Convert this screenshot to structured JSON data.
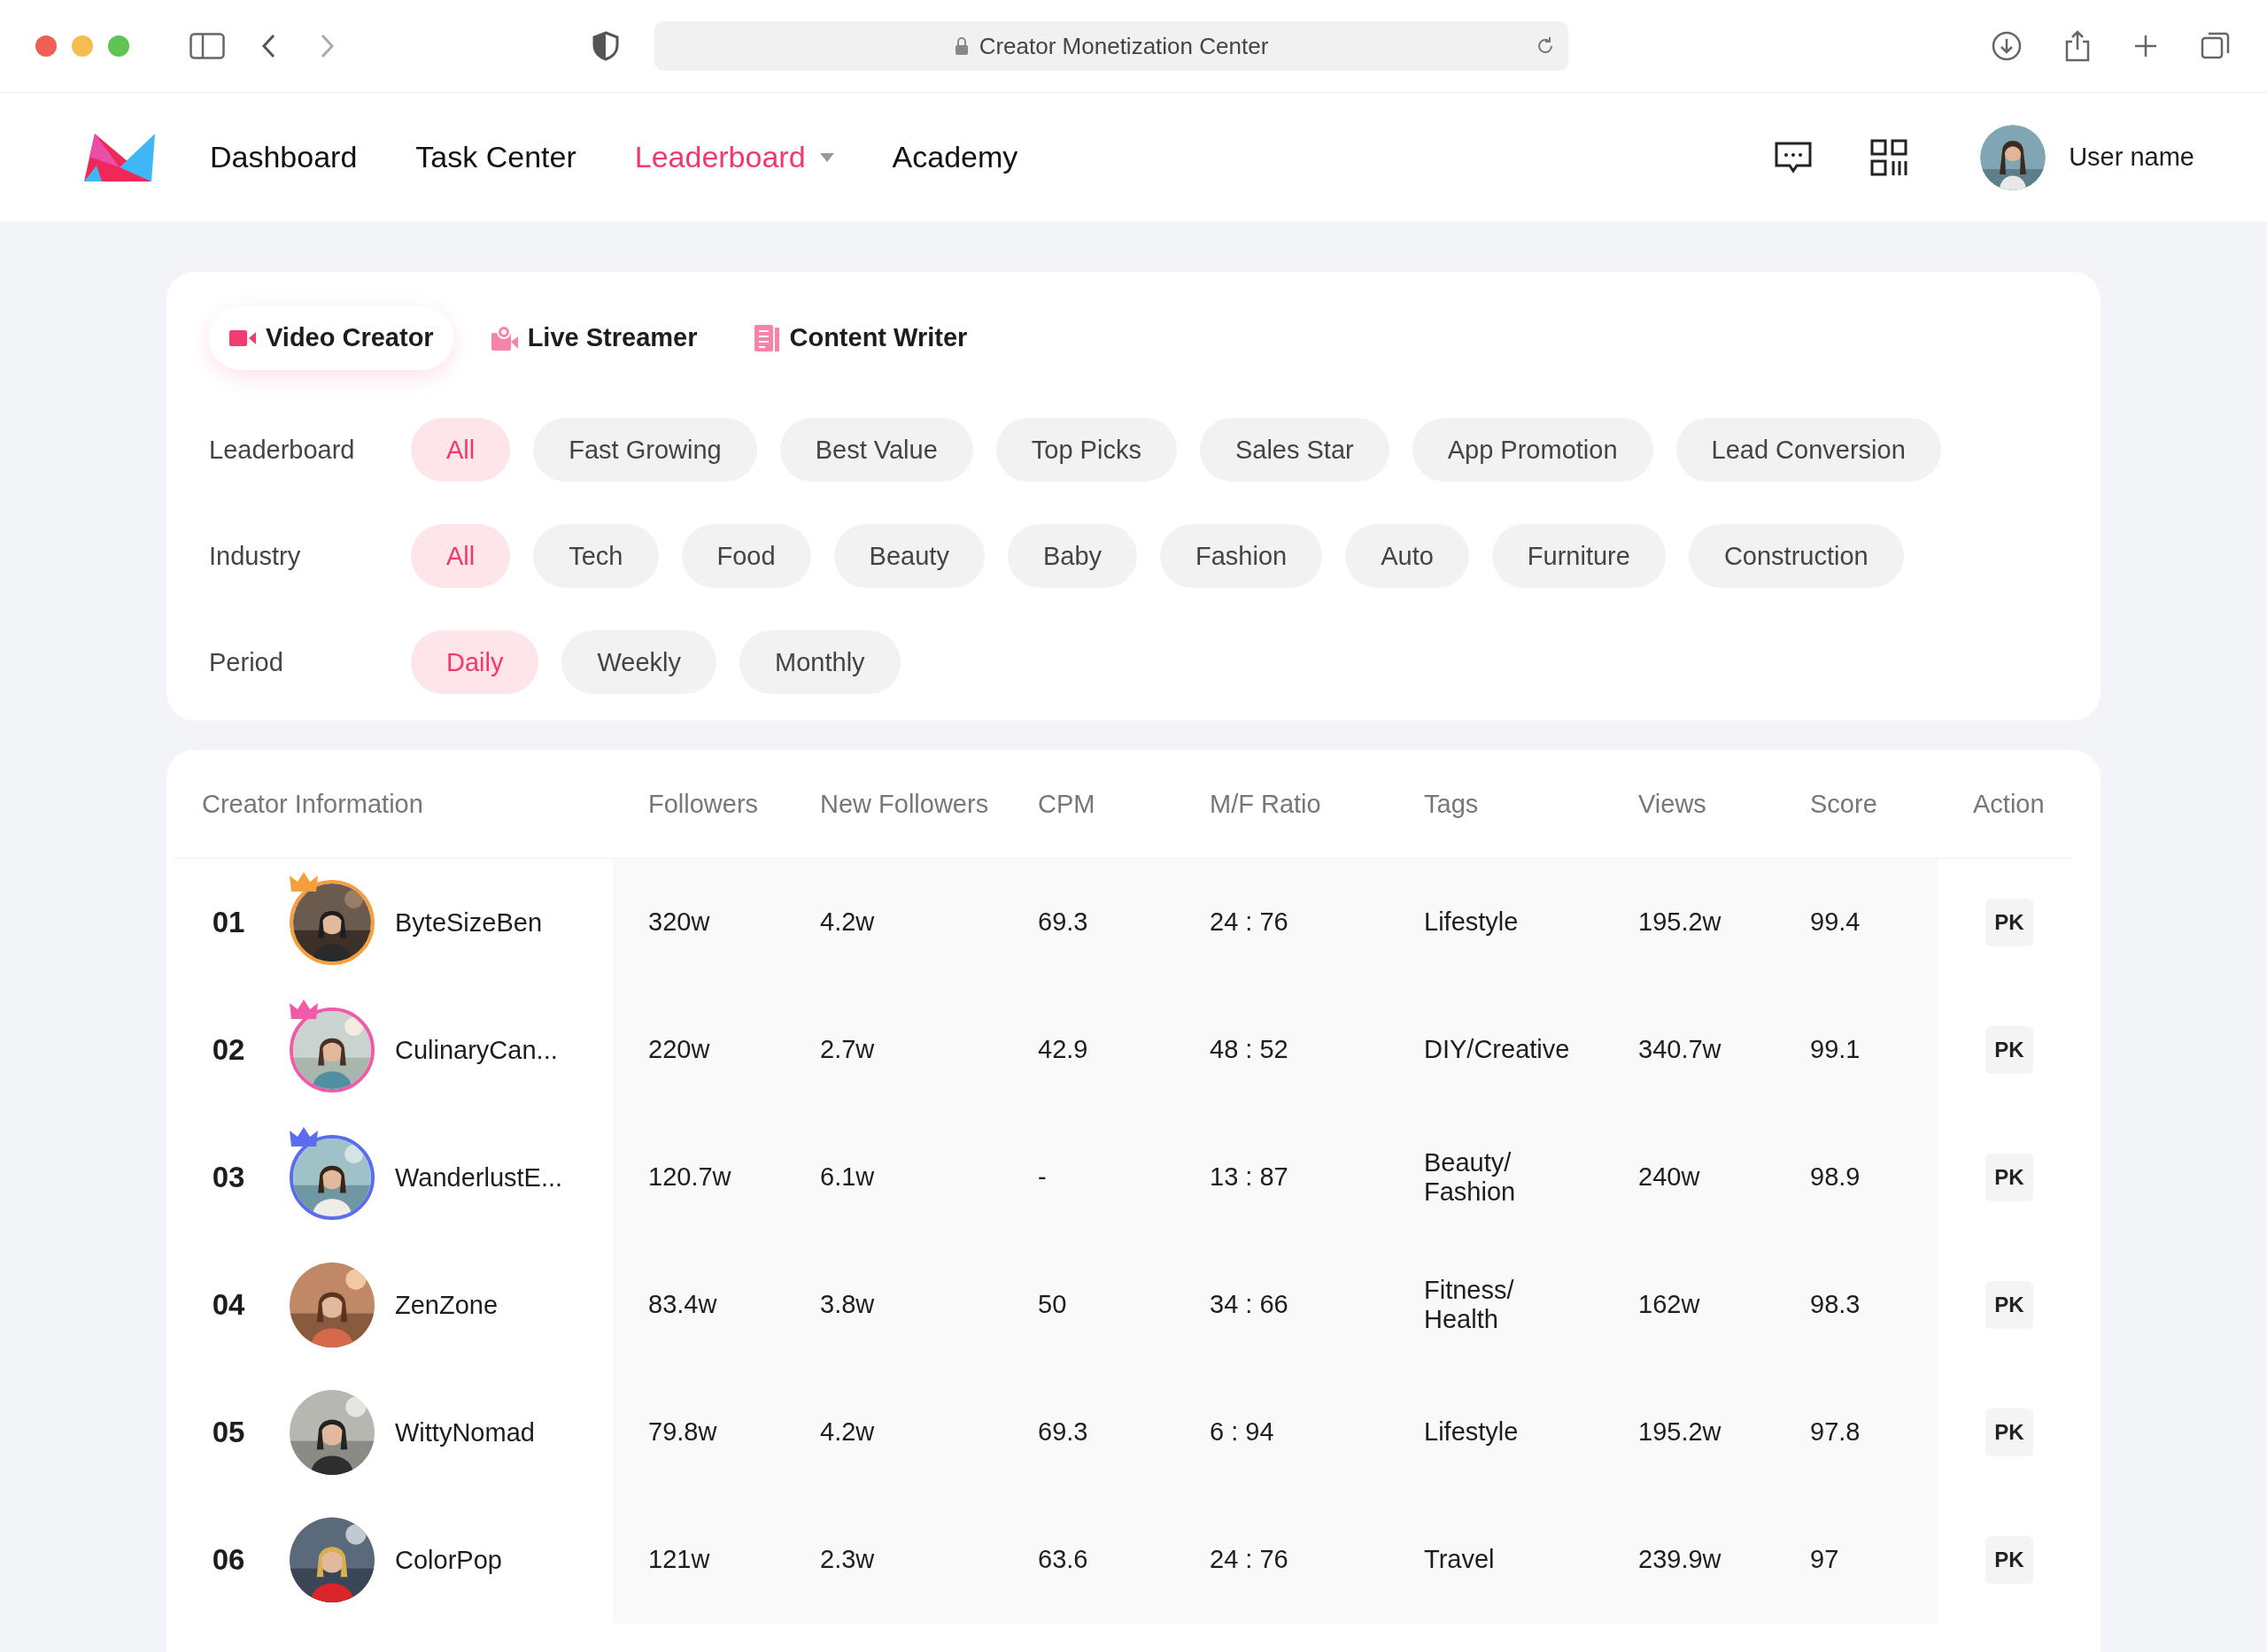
{
  "browser": {
    "url": "Creator Monetization Center"
  },
  "nav": {
    "items": [
      {
        "label": "Dashboard",
        "selected": false,
        "dropdown": false
      },
      {
        "label": "Task Center",
        "selected": false,
        "dropdown": false
      },
      {
        "label": "Leaderboard",
        "selected": true,
        "dropdown": true
      },
      {
        "label": "Academy",
        "selected": false,
        "dropdown": false
      }
    ],
    "user": "User name"
  },
  "creator_types": [
    {
      "label": "Video Creator",
      "selected": true,
      "kind": "video"
    },
    {
      "label": "Live Streamer",
      "selected": false,
      "kind": "live"
    },
    {
      "label": "Content Writer",
      "selected": false,
      "kind": "writer"
    }
  ],
  "filters": [
    {
      "label": "Leaderboard",
      "options": [
        {
          "label": "All",
          "selected": true
        },
        {
          "label": "Fast Growing",
          "selected": false
        },
        {
          "label": "Best Value",
          "selected": false
        },
        {
          "label": "Top Picks",
          "selected": false
        },
        {
          "label": "Sales Star",
          "selected": false
        },
        {
          "label": "App Promotion",
          "selected": false
        },
        {
          "label": "Lead Conversion",
          "selected": false
        }
      ]
    },
    {
      "label": "Industry",
      "options": [
        {
          "label": "All",
          "selected": true
        },
        {
          "label": "Tech",
          "selected": false
        },
        {
          "label": "Food",
          "selected": false
        },
        {
          "label": "Beauty",
          "selected": false
        },
        {
          "label": "Baby",
          "selected": false
        },
        {
          "label": "Fashion",
          "selected": false
        },
        {
          "label": "Auto",
          "selected": false
        },
        {
          "label": "Furniture",
          "selected": false
        },
        {
          "label": "Construction",
          "selected": false
        }
      ]
    },
    {
      "label": "Period",
      "options": [
        {
          "label": "Daily",
          "selected": true
        },
        {
          "label": "Weekly",
          "selected": false
        },
        {
          "label": "Monthly",
          "selected": false
        }
      ]
    }
  ],
  "table": {
    "columns": [
      "Creator Information",
      "Followers",
      "New Followers",
      "CPM",
      "M/F Ratio",
      "Tags",
      "Views",
      "Score",
      "Action"
    ],
    "rows": [
      {
        "rank": "01",
        "name": "ByteSizeBen",
        "color": "#f5a03c",
        "followers": "320w",
        "new_followers": "4.2w",
        "cpm": "69.3",
        "mf_ratio": "24 : 76",
        "tags": "Lifestyle",
        "views": "195.2w",
        "score": "99.4",
        "action": "PK"
      },
      {
        "rank": "02",
        "name": "CulinaryCan...",
        "color": "#f05aa8",
        "followers": "220w",
        "new_followers": "2.7w",
        "cpm": "42.9",
        "mf_ratio": "48 : 52",
        "tags": "DIY/Creative",
        "views": "340.7w",
        "score": "99.1",
        "action": "PK"
      },
      {
        "rank": "03",
        "name": "WanderlustE...",
        "color": "#5a6cf0",
        "followers": "120.7w",
        "new_followers": "6.1w",
        "cpm": "-",
        "mf_ratio": "13 : 87",
        "tags": "Beauty/ Fashion",
        "views": "240w",
        "score": "98.9",
        "action": "PK"
      },
      {
        "rank": "04",
        "name": "ZenZone",
        "followers": "83.4w",
        "new_followers": "3.8w",
        "cpm": "50",
        "mf_ratio": "34 : 66",
        "tags": "Fitness/ Health",
        "views": "162w",
        "score": "98.3",
        "action": "PK"
      },
      {
        "rank": "05",
        "name": "WittyNomad",
        "followers": "79.8w",
        "new_followers": "4.2w",
        "cpm": "69.3",
        "mf_ratio": "6 : 94",
        "tags": "Lifestyle",
        "views": "195.2w",
        "score": "97.8",
        "action": "PK"
      },
      {
        "rank": "06",
        "name": "ColorPop",
        "followers": "121w",
        "new_followers": "2.3w",
        "cpm": "63.6",
        "mf_ratio": "24 : 76",
        "tags": "Travel",
        "views": "239.9w",
        "score": "97",
        "action": "PK"
      }
    ]
  }
}
